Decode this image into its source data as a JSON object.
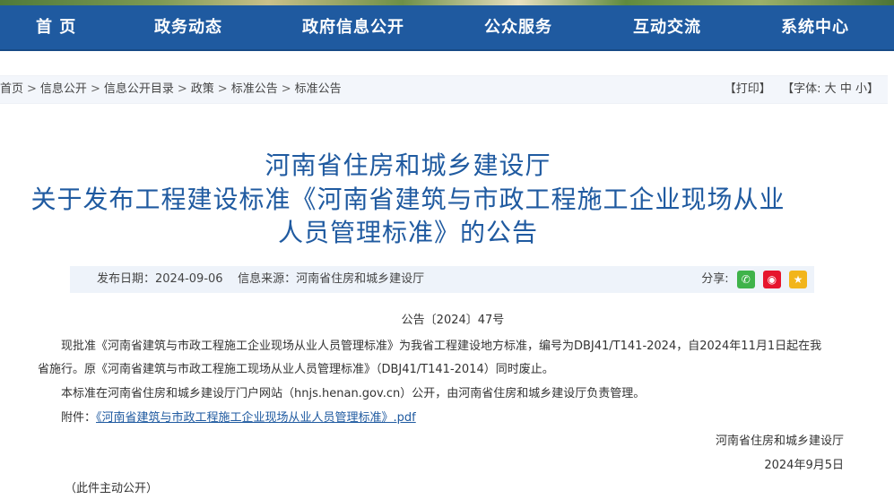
{
  "nav": {
    "items": [
      "首 页",
      "政务动态",
      "政府信息公开",
      "公众服务",
      "互动交流",
      "系统中心"
    ]
  },
  "breadcrumb": {
    "items": [
      "首页",
      "信息公开",
      "信息公开目录",
      "政策",
      "标准公告",
      "标准公告"
    ],
    "separator": ">"
  },
  "tools": {
    "print": "【打印】",
    "font_label": "【字体:",
    "font_large": "大",
    "font_medium": "中",
    "font_small": "小",
    "font_close": "】"
  },
  "article": {
    "title_line1": "河南省住房和城乡建设厅",
    "title_line2": "关于发布工程建设标准《河南省建筑与市政工程施工企业现场从业",
    "title_line3": "人员管理标准》的公告",
    "meta_date": "发布日期：2024-09-06",
    "meta_source": "信息来源：河南省住房和城乡建设厅",
    "share_label": "分享:",
    "doc_no": "公告〔2024〕47号",
    "para1_line1": "现批准《河南省建筑与市政工程施工企业现场从业人员管理标准》为我省工程建设地方标准，编号为DBJ41/T141-2024，自2024年11月1日起在我",
    "para1_line2": "省施行。原《河南省建筑与市政工程施工现场从业人员管理标准》（DBJ41/T141-2014）同时废止。",
    "para2": "本标准在河南省住房和城乡建设厅门户网站（hnjs.henan.gov.cn）公开，由河南省住房和城乡建设厅负责管理。",
    "attach_label": "附件：",
    "attach_link": "《河南省建筑与市政工程施工企业现场从业人员管理标准》.pdf",
    "sign_org": "河南省住房和城乡建设厅",
    "sign_date": "2024年9月5日",
    "footnote": "（此件主动公开）"
  },
  "colors": {
    "nav_bg": "#1f5aa0",
    "title": "#1f5aa0",
    "meta_bg": "#eef3fa",
    "crumb_bg": "#f3f6fb"
  }
}
